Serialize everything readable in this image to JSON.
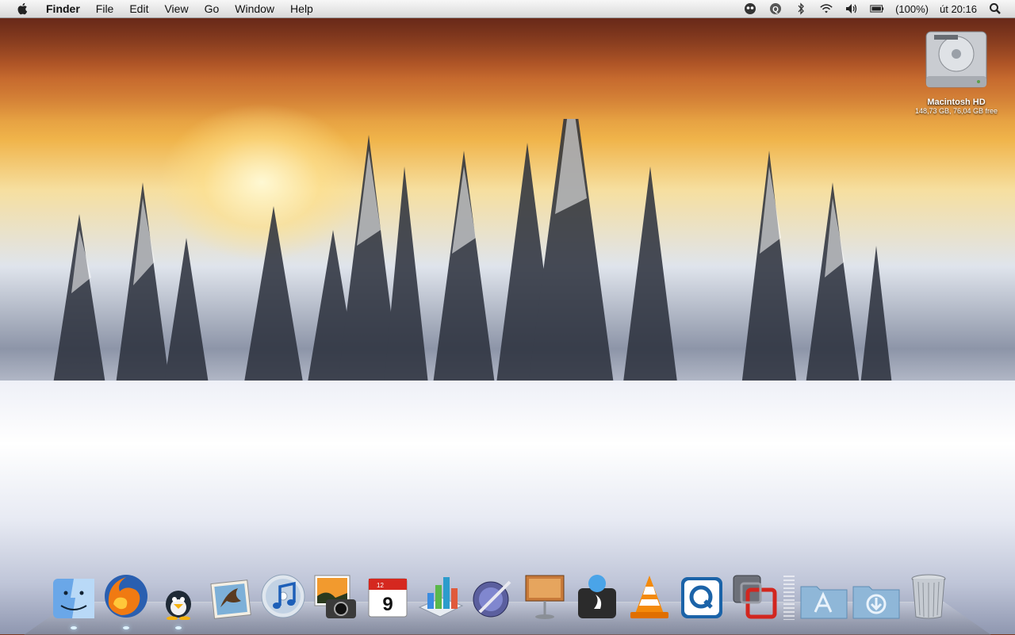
{
  "menubar": {
    "apple_icon": "apple-logo-icon",
    "app_name": "Finder",
    "items": [
      {
        "label": "File"
      },
      {
        "label": "Edit"
      },
      {
        "label": "View"
      },
      {
        "label": "Go"
      },
      {
        "label": "Window"
      },
      {
        "label": "Help"
      }
    ],
    "status": {
      "icons": [
        "alien-icon",
        "quicksilver-icon",
        "bluetooth-icon",
        "wifi-icon",
        "volume-icon",
        "battery-icon"
      ],
      "battery_text": "(100%)",
      "clock": "út 20:16",
      "spotlight_icon": "spotlight-search-icon"
    }
  },
  "desktop": {
    "drive": {
      "name": "Macintosh HD",
      "info": "148,73 GB, 76,04 GB free",
      "icon": "hard-drive-icon"
    }
  },
  "dock": {
    "apps": [
      {
        "icon": "finder-icon",
        "running": true
      },
      {
        "icon": "firefox-icon",
        "running": true
      },
      {
        "icon": "adium-icon",
        "running": true
      },
      {
        "icon": "mail-icon",
        "running": false
      },
      {
        "icon": "itunes-icon",
        "running": false
      },
      {
        "icon": "iphoto-icon",
        "running": false
      },
      {
        "icon": "ical-icon",
        "running": false,
        "date": "9",
        "month": "12"
      },
      {
        "icon": "numbers-icon",
        "running": false
      },
      {
        "icon": "iwork-icon",
        "running": false
      },
      {
        "icon": "keynote-icon",
        "running": false
      },
      {
        "icon": "toast-icon",
        "running": false
      },
      {
        "icon": "vlc-icon",
        "running": false
      },
      {
        "icon": "quicksilver-dock-icon",
        "running": false
      },
      {
        "icon": "vmware-icon",
        "running": false
      }
    ],
    "stacks": [
      {
        "icon": "applications-folder-icon"
      },
      {
        "icon": "downloads-folder-icon"
      },
      {
        "icon": "trash-icon"
      }
    ]
  }
}
